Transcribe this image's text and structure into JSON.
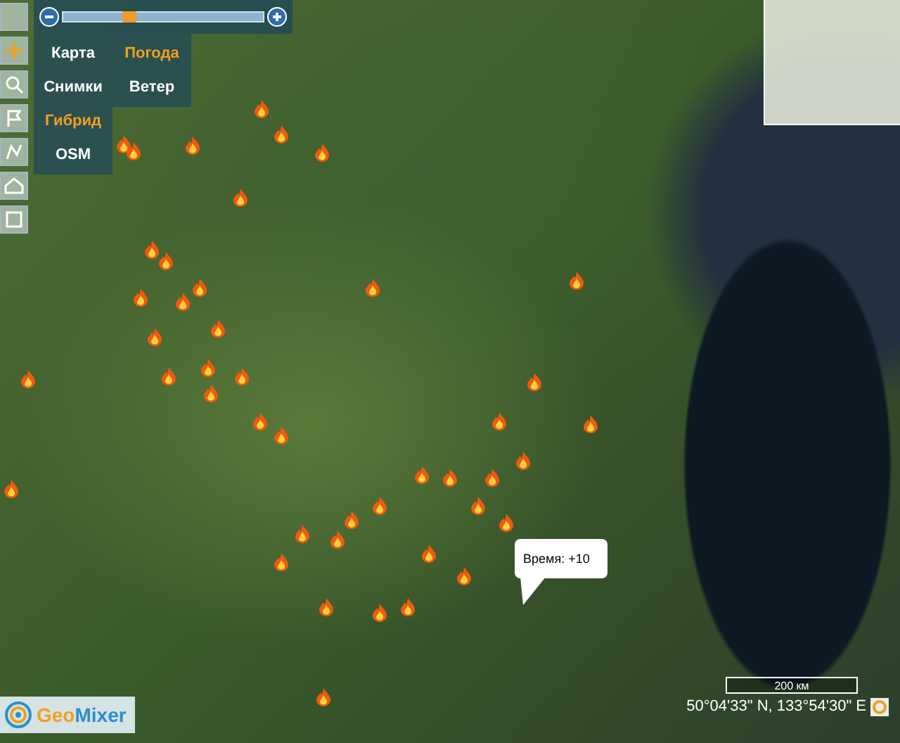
{
  "zoom_slider": {
    "level": 0.33
  },
  "base_layers": [
    {
      "label": "Карта",
      "selected": false
    },
    {
      "label": "Снимки",
      "selected": false
    },
    {
      "label": "Гибрид",
      "selected": true
    },
    {
      "label": "OSM",
      "selected": false
    }
  ],
  "overlays": [
    {
      "label": "Погода",
      "on": true
    },
    {
      "label": "Ветер",
      "on": false
    }
  ],
  "popup": {
    "text": "Время: +10"
  },
  "scale": "200 км",
  "coordinates": "50°04'33\" N, 133°54'30\" E",
  "logo": {
    "part_1": "Geo",
    "part_2": "Mixer"
  }
}
